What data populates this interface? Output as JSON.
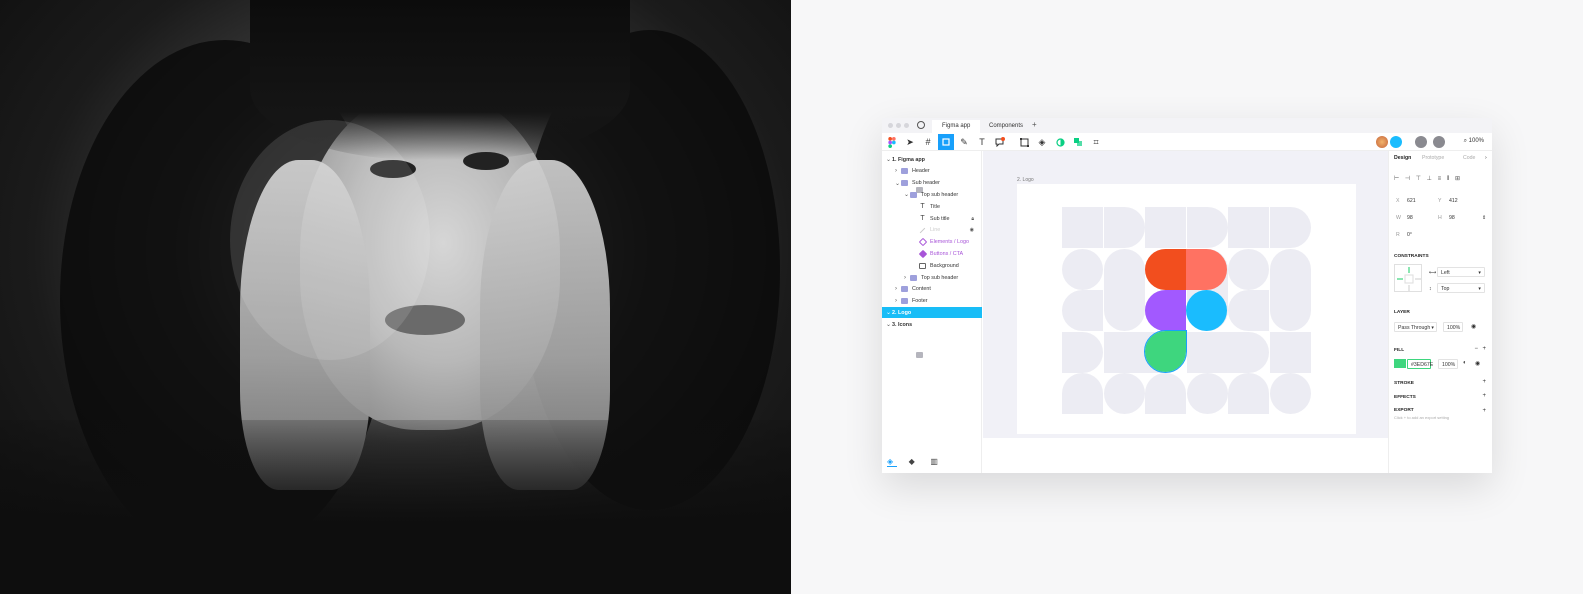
{
  "figma": {
    "tabs": [
      "Figma app",
      "Components"
    ],
    "tab_add": "+",
    "zoom": "100%",
    "layers": [
      {
        "label": "1. Figma app",
        "icon": "frame",
        "indent": 0,
        "chevron": "v",
        "style": "bold"
      },
      {
        "label": "Header",
        "icon": "folder",
        "indent": 1,
        "chevron": ">",
        "style": ""
      },
      {
        "label": "Sub header",
        "icon": "folder",
        "indent": 1,
        "chevron": "v",
        "style": ""
      },
      {
        "label": "Top sub header",
        "icon": "folder",
        "indent": 2,
        "chevron": "v",
        "style": ""
      },
      {
        "label": "Title",
        "icon": "text",
        "indent": 3,
        "chevron": "",
        "style": ""
      },
      {
        "label": "Sub title",
        "icon": "text",
        "indent": 3,
        "chevron": "",
        "style": "",
        "trailing": "lock"
      },
      {
        "label": "Line",
        "icon": "line",
        "indent": 3,
        "chevron": "",
        "style": "faded",
        "trailing": "eye"
      },
      {
        "label": "Elements / Logo",
        "icon": "comp",
        "indent": 3,
        "chevron": "",
        "style": "purple"
      },
      {
        "label": "Buttons / CTA",
        "icon": "compfill",
        "indent": 3,
        "chevron": "",
        "style": "purple"
      },
      {
        "label": "Background",
        "icon": "rect",
        "indent": 3,
        "chevron": "",
        "style": ""
      },
      {
        "label": "Top sub header",
        "icon": "folder",
        "indent": 2,
        "chevron": ">",
        "style": ""
      },
      {
        "label": "Content",
        "icon": "folder",
        "indent": 1,
        "chevron": ">",
        "style": ""
      },
      {
        "label": "Footer",
        "icon": "folder",
        "indent": 1,
        "chevron": ">",
        "style": ""
      },
      {
        "label": "2. Logo",
        "icon": "frame",
        "indent": 0,
        "chevron": "v",
        "style": "bold",
        "selected": true
      },
      {
        "label": "3. Icons",
        "icon": "frame",
        "indent": 0,
        "chevron": "v",
        "style": "bold"
      }
    ],
    "canvas": {
      "frame_label": "2. Logo"
    },
    "properties": {
      "tabs": [
        "Design",
        "Prototype",
        "Code"
      ],
      "x_label": "X",
      "x_value": "621",
      "y_label": "Y",
      "y_value": "412",
      "w_label": "W",
      "w_value": "98",
      "h_label": "H",
      "h_value": "98",
      "r_label": "R",
      "r_value": "0°",
      "constraints_title": "CONSTRAINTS",
      "constraint_h": "Left",
      "constraint_v": "Top",
      "layer_title": "LAYER",
      "blend": "Pass Through",
      "layer_opacity": "100%",
      "fill_title": "FILL",
      "fill_hex": "#3ED67E",
      "fill_opacity": "100%",
      "stroke_title": "STROKE",
      "effects_title": "EFFECTS",
      "export_title": "EXPORT",
      "export_hint": "Click + to add an export setting"
    }
  },
  "colors": {
    "figma_red": "#f24e1e",
    "figma_coral": "#ff7262",
    "figma_purple": "#a259ff",
    "figma_blue": "#1abcfe",
    "figma_green": "#0acf83",
    "accent": "#18a0fb"
  }
}
